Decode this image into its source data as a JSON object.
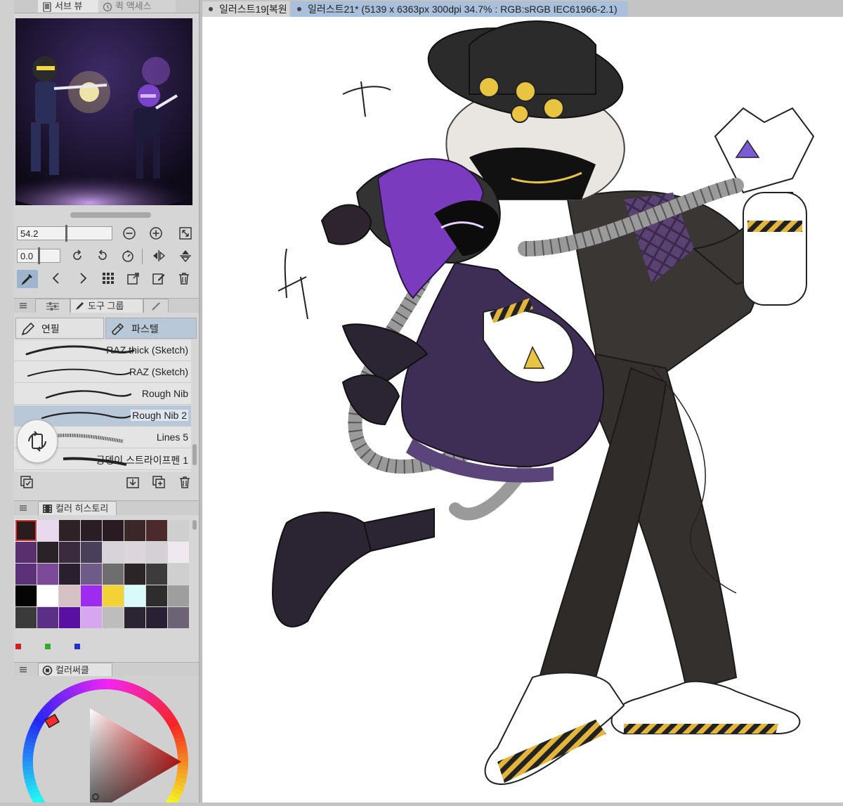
{
  "sub_view_tabs": {
    "sub_view": "서브 뷰",
    "quick_access": "퀵 액세스"
  },
  "navigator": {
    "zoom_value": "54.2",
    "rotation_value": "0.0"
  },
  "tool_panel": {
    "tool_group_tab": "도구 그룹"
  },
  "subtools": {
    "pencil": "연필",
    "pastel": "파스텔",
    "selected": "파스텔"
  },
  "brushes": [
    {
      "name": "RAZ thick (Sketch)"
    },
    {
      "name": "RAZ (Sketch)"
    },
    {
      "name": "Rough Nib"
    },
    {
      "name": "Rough Nib 2",
      "selected": true
    },
    {
      "name": "Lines 5"
    },
    {
      "name": "궁뎅이 스트라이프펜 1"
    }
  ],
  "color_history": {
    "title": "컬러 히스토리",
    "swatches": [
      "#2a1c1c",
      "#e8d9ee",
      "#2e2226",
      "#2a1d24",
      "#2a1b22",
      "#3b2628",
      "#4b2a2b",
      "#cfcfcf",
      "#5a2f6e",
      "#2b2228",
      "#3b2b3f",
      "#4a3f59",
      "#d8d3d8",
      "#dcd6dc",
      "#d5d0d5",
      "#efe9ef",
      "#5b3178",
      "#7d4a9a",
      "#2a1f2e",
      "#6f5b88",
      "#6e6e6e",
      "#2b2528",
      "#3c3c3c",
      "#cfcfcf",
      "#050505",
      "#ffffff",
      "#d6c2c4",
      "#9d2bf0",
      "#f2d234",
      "#d7fbfa",
      "#2d2d2d",
      "#9e9e9e",
      "#3a3a3a",
      "#5b2f85",
      "#5a0fa3",
      "#d6a6ee",
      "#bdbdbd",
      "#2a2433",
      "#2a2033",
      "#6c6475"
    ],
    "rgb": [
      "#cc2222",
      "#33aa33",
      "#2233cc"
    ]
  },
  "color_circle": {
    "title": "컬러써클",
    "current_color": "#ff2a2a"
  },
  "document_tabs": [
    {
      "label": "일러스트19[복원"
    },
    {
      "label": "일러스트21* (5139 x 6363px 300dpi 34.7% : RGB:sRGB IEC61966-2.1)",
      "active": true
    }
  ],
  "colors": {
    "selection_blue": "#a9c0dc",
    "panel_bg": "#d6d6d6"
  }
}
